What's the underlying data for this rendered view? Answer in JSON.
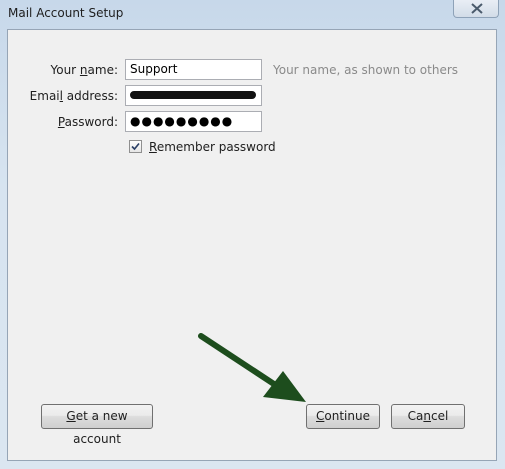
{
  "window": {
    "title": "Mail Account Setup",
    "close_icon": "close-icon"
  },
  "form": {
    "name_label_pre": "Your ",
    "name_label_u": "n",
    "name_label_post": "ame:",
    "name_value": "Support",
    "name_hint": "Your name, as shown to others",
    "email_label_pre": "Emai",
    "email_label_u": "l",
    "email_label_post": " address:",
    "password_label_u": "P",
    "password_label_post": "assword:",
    "password_value": "●●●●●●●●●",
    "remember_pre": "",
    "remember_u": "R",
    "remember_post": "emember password",
    "remember_checked": true
  },
  "buttons": {
    "new_account_u": "G",
    "new_account_post": "et a new account",
    "continue_u": "C",
    "continue_post": "ontinue",
    "cancel_pre": "Ca",
    "cancel_u": "n",
    "cancel_post": "cel"
  },
  "annotation": {
    "arrow_color": "#1d4d1d"
  }
}
